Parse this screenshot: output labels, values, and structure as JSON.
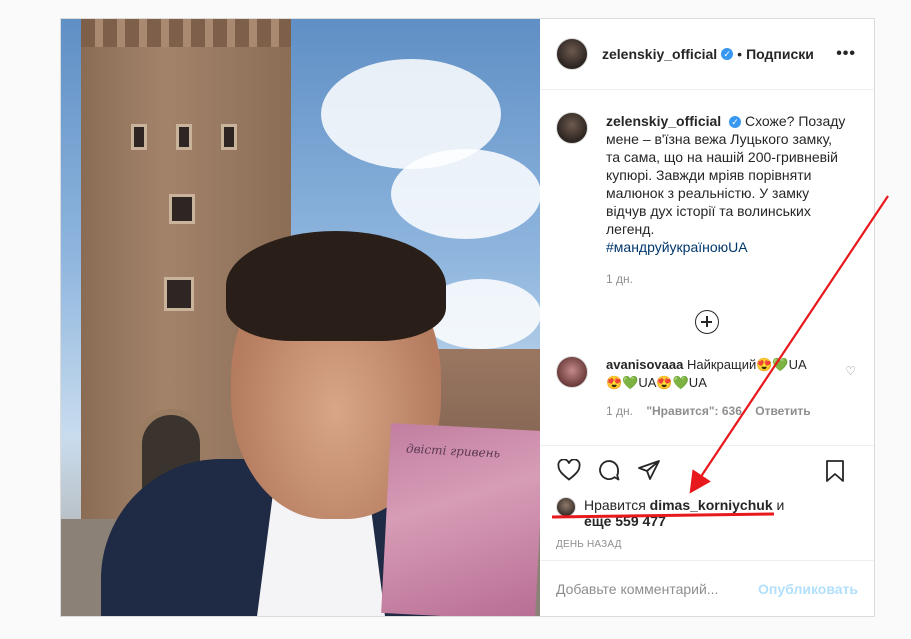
{
  "post": {
    "author": {
      "username": "zelenskiy_official",
      "verified_icon": "verified-badge-icon",
      "follow_state": "Подписки",
      "separator": "•"
    },
    "more_icon": "more-options-icon",
    "caption": {
      "text": "Схоже? Позаду мене – в'їзна вежа Луцького замку, та сама, що на нашій 200-гривневій купюрі. Завжди мріяв порівняти малюнок з реальністю. У замку відчув дух історії та волинських легенд.",
      "hashtag": "#мандруйукраїноюUA",
      "age": "1 дн."
    },
    "photo": {
      "banknote_text": "двісті гривень"
    },
    "comments": [
      {
        "username": "avanisovaaa",
        "text": "Найкращий😍💚UA 😍💚UA😍💚UA",
        "age": "1 дн.",
        "likes": "\"Нравится\": 636",
        "reply_label": "Ответить"
      }
    ],
    "likes": {
      "prefix": "Нравится",
      "user": "dimas_korniychuk",
      "suffix": "и",
      "others": "еще 559 477"
    },
    "time_ago": "День назад",
    "comment_input": {
      "placeholder": "Добавьте комментарий...",
      "publish_label": "Опубликовать"
    }
  },
  "colors": {
    "annotation": "#e8191c",
    "verified": "#3897f0",
    "publish_disabled": "#b2dffc"
  }
}
